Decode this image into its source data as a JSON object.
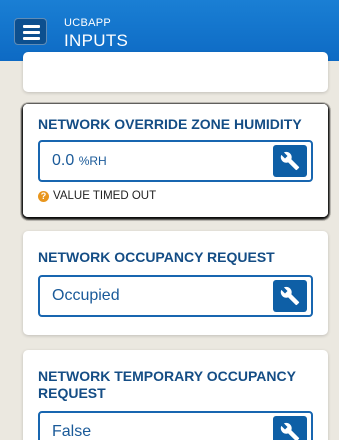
{
  "header": {
    "app_name": "UCBAPP",
    "page_title": "INPUTS",
    "menu_icon": "hamburger-menu-icon"
  },
  "cards": [
    {
      "title": "NETWORK OVERRIDE ZONE HUMIDITY",
      "value": "0.0",
      "unit": "%RH",
      "warning": "VALUE TIMED OUT",
      "warning_icon": "question-icon",
      "edit_icon": "wrench-icon"
    },
    {
      "title": "NETWORK OCCUPANCY REQUEST",
      "value": "Occupied",
      "edit_icon": "wrench-icon"
    },
    {
      "title": "NETWORK TEMPORARY OCCUPANCY REQUEST",
      "value": "False",
      "edit_icon": "wrench-icon"
    }
  ],
  "colors": {
    "header": "#0d6ac4",
    "title_text": "#144d85",
    "field_border": "#1866b0",
    "button": "#0e5fa6",
    "warning": "#e8961e",
    "background": "#ebe8e0"
  }
}
